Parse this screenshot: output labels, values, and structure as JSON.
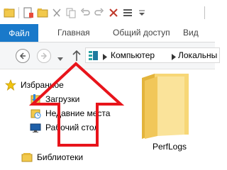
{
  "title_bar": {
    "title_partial": "",
    "qat_icons": [
      "explorer-icon",
      "properties-icon",
      "new-folder-icon",
      "cut-icon",
      "copy-icon",
      "undo-icon",
      "redo-icon",
      "delete-icon",
      "customize-qat-icon"
    ]
  },
  "ribbon": {
    "tabs": [
      {
        "label": "Файл",
        "active": true
      },
      {
        "label": "Главная"
      },
      {
        "label": "Общий доступ"
      },
      {
        "label": "Вид"
      }
    ],
    "accent": "#1979ca"
  },
  "address_bar": {
    "path": [
      "Компьютер",
      "Локальны"
    ]
  },
  "nav_pane": {
    "favorites_label": "Избранное",
    "items": [
      {
        "label": "Загрузки",
        "icon": "downloads-icon"
      },
      {
        "label": "Недавние места",
        "icon": "recent-places-icon"
      },
      {
        "label": "Рабочий стол",
        "icon": "desktop-icon"
      }
    ],
    "libraries_label": "Библиотеки"
  },
  "content": {
    "items": [
      {
        "label": "PerfLogs",
        "icon": "folder-icon"
      }
    ]
  },
  "annotation": {
    "icon": "red-up-arrow-icon",
    "color": "#e8141b"
  }
}
